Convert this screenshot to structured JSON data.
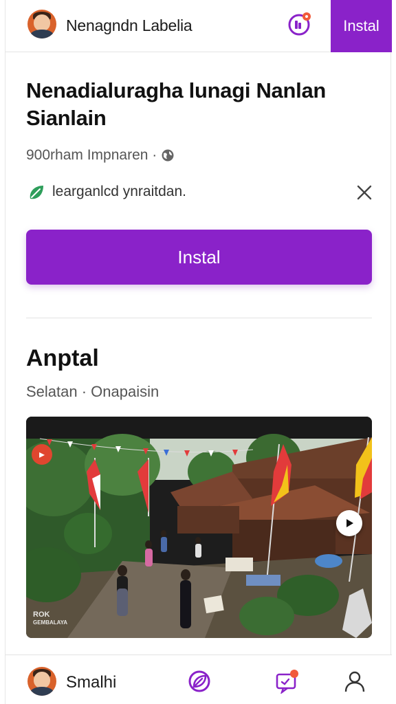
{
  "header": {
    "title": "Nenagndn Labelia",
    "install_label": "Instal"
  },
  "listing": {
    "title": "Nenadialuragha lunagi Nanlan Sianlain",
    "meta": "900rham Impnaren ·",
    "verified_text": "learganlcd ynraitdan.",
    "install_label": "Instal"
  },
  "section": {
    "title": "Anptal",
    "subtitle": "Selatan · Onapaisin"
  },
  "media": {
    "watermark_line1": "ROK",
    "watermark_line2": "GEMBALAYA"
  },
  "bottom_nav": {
    "profile_name": "Smalhi"
  },
  "colors": {
    "accent": "#8a22c9",
    "notification": "#f15a3a",
    "verified_leaf": "#2e9e5b"
  },
  "icons": {
    "header": [
      "avatar",
      "notification-icon"
    ],
    "meta": [
      "globe-icon"
    ],
    "verified": [
      "leaf-icon",
      "close-icon"
    ],
    "bottom_nav": [
      "avatar",
      "explore-icon",
      "messages-icon",
      "profile-icon"
    ]
  }
}
